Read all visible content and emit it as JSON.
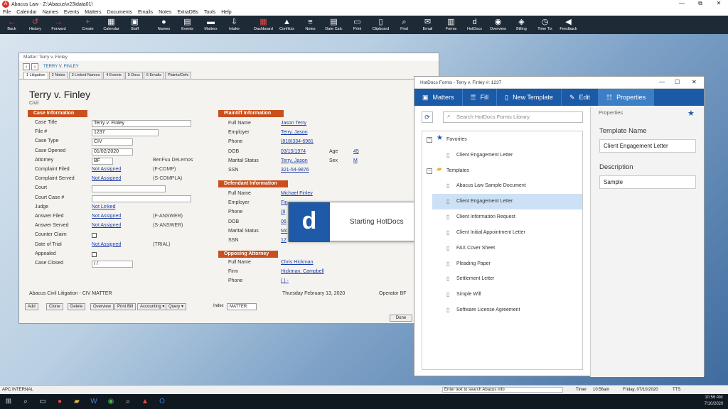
{
  "app": {
    "title": "Abacus Law - Z:\\Abacus\\v23\\data01\\",
    "logo": "A",
    "minimize": "—",
    "maximize": "⧉",
    "close": "✕"
  },
  "menu": [
    "File",
    "Calendar",
    "Names",
    "Events",
    "Matters",
    "Documents",
    "Emails",
    "Notes",
    "ExtraDBs",
    "Tools",
    "Help"
  ],
  "toolbar": [
    {
      "label": "Back",
      "icon": "←",
      "red": true
    },
    {
      "label": "History",
      "icon": "↺",
      "red": true
    },
    {
      "label": "Forward",
      "icon": "→",
      "red": true
    },
    {
      "label": "Create",
      "icon": "+",
      "red": true
    },
    {
      "label": "Calendar",
      "icon": "▦"
    },
    {
      "label": "Staff",
      "icon": "▣"
    },
    {
      "label": "Names",
      "icon": "●"
    },
    {
      "label": "Events",
      "icon": "▤"
    },
    {
      "label": "Matters",
      "icon": "▬"
    },
    {
      "label": "Intake",
      "icon": "⇩"
    },
    {
      "label": "Dashboard",
      "icon": "▦",
      "red": true
    },
    {
      "label": "Conflicts",
      "icon": "▲"
    },
    {
      "label": "Notes",
      "icon": "≡"
    },
    {
      "label": "Date Calc",
      "icon": "▤"
    },
    {
      "label": "Print",
      "icon": "▭"
    },
    {
      "label": "Clipboard",
      "icon": "▯"
    },
    {
      "label": "Find",
      "icon": "⌕"
    },
    {
      "label": "Email",
      "icon": "✉"
    },
    {
      "label": "Forms",
      "icon": "▥"
    },
    {
      "label": "HotDocs",
      "icon": "d"
    },
    {
      "label": "Overview",
      "icon": "◉"
    },
    {
      "label": "Billing",
      "icon": "◈"
    },
    {
      "label": "Time Tix",
      "icon": "◷"
    },
    {
      "label": "Feedback",
      "icon": "◀"
    }
  ],
  "matter": {
    "window_title": "Matter: Terry v. Finley",
    "nav_label": "TERRY V. FINLEY",
    "tabs": [
      "1 Litigation",
      "2 Notes",
      "3 Linked Names",
      "4 Events",
      "5 Docs",
      "6 Emails",
      "Plaints/Defs"
    ],
    "title": "Terry v. Finley",
    "subtitle": "Civil",
    "case_header": "Case Information",
    "case_fields": [
      {
        "label": "Case Title",
        "value": "Terry v. Finley",
        "kind": "box"
      },
      {
        "label": "File #",
        "value": "1237",
        "kind": "box"
      },
      {
        "label": "Case Type",
        "value": "CIV",
        "kind": "box"
      },
      {
        "label": "Case Opened",
        "value": "01/02/2020",
        "kind": "box"
      },
      {
        "label": "Attorney",
        "value": "BF",
        "kind": "box",
        "note": "BenFuu DeLemos"
      },
      {
        "label": "Complaint Filed",
        "value": "Not Assigned",
        "kind": "link",
        "note": "(F-COMP)"
      },
      {
        "label": "Complaint Served",
        "value": "Not Assigned",
        "kind": "link",
        "note": "(S-COMPLA)"
      },
      {
        "label": "Court",
        "value": "",
        "kind": "box"
      },
      {
        "label": "Court Case #",
        "value": "",
        "kind": "box"
      },
      {
        "label": "Judge",
        "value": "Not Linked",
        "kind": "link"
      },
      {
        "label": "Answer Filed",
        "value": "Not Assigned",
        "kind": "link",
        "note": "(F-ANSWER)"
      },
      {
        "label": "Answer Served",
        "value": "Not Assigned",
        "kind": "link",
        "note": "(S-ANSWER)"
      },
      {
        "label": "Counter Claim",
        "value": "",
        "kind": "check"
      },
      {
        "label": "Date of Trial",
        "value": "Not Assigned",
        "kind": "link",
        "note": "(TRIAL)"
      },
      {
        "label": "Appealed",
        "value": "",
        "kind": "check"
      },
      {
        "label": "Case Closed",
        "value": "/ /",
        "kind": "box"
      }
    ],
    "plaintiff_header": "Plaintiff Information",
    "plaintiff": [
      {
        "label": "Full Name",
        "value": "Jason Terry"
      },
      {
        "label": "Employer",
        "value": "Terry, Jason"
      },
      {
        "label": "Phone",
        "value": "(818)334-6981"
      },
      {
        "label": "DOB",
        "value": "03/15/1974"
      },
      {
        "label": "Marital Status",
        "value": "Terry, Jason"
      },
      {
        "label": "SSN",
        "value": "321-54-9876"
      }
    ],
    "plaintiff_extra": {
      "age_label": "Age",
      "age": "45",
      "sex_label": "Sex",
      "sex": "M"
    },
    "defendant_header": "Defendant Information",
    "defendant": [
      {
        "label": "Full Name",
        "value": "Michael Finley"
      },
      {
        "label": "Employer",
        "value": "Fin"
      },
      {
        "label": "Phone",
        "value": "(8"
      },
      {
        "label": "DOB",
        "value": "06"
      },
      {
        "label": "Marital Status",
        "value": "Mc"
      },
      {
        "label": "SSN",
        "value": "12"
      }
    ],
    "opposing_header": "Opposing Attorney",
    "opposing": [
      {
        "label": "Full Name",
        "value": "Chris Hickman"
      },
      {
        "label": "Firm",
        "value": "Hickman, Campbell"
      },
      {
        "label": "Phone",
        "value": "( ) -"
      }
    ],
    "footer_left": "Abacus Civil Litigation - CIV MATTER",
    "footer_date": "Thursday February 13, 2020",
    "footer_operator": "Operator BF",
    "buttons": [
      "Add",
      "Clone",
      "Delete",
      "Overview",
      "Print Bill",
      "Accounting ▾",
      "Query ▾"
    ],
    "index_label": "Index",
    "index_value": "MATTER",
    "done": "Done"
  },
  "splash": {
    "logo": "d",
    "text": "Starting HotDocs"
  },
  "hotdocs": {
    "window_title": "HotDocs Forms - Terry v. Finley #: 1237",
    "tabs": [
      {
        "label": "Matters",
        "icon": "▣"
      },
      {
        "label": "Fill",
        "icon": "☰"
      },
      {
        "label": "New Template",
        "icon": "▯"
      },
      {
        "label": "Edit",
        "icon": "✎"
      },
      {
        "label": "Properties",
        "icon": "☷"
      }
    ],
    "search_placeholder": "Search HotDocs Forms Library",
    "favorites_label": "Favorites",
    "favorites": [
      "Client Engagement Letter"
    ],
    "templates_label": "Templates",
    "templates": [
      "Abacus Law Sample Document",
      "Client Engagement Letter",
      "Client Information Request",
      "Client Initial Appointment Letter",
      "FAX Cover Sheet",
      "Pleading Paper",
      "Settlement Letter",
      "Simple Will",
      "Software License Agreement"
    ],
    "props_header": "Properties",
    "template_name_label": "Template Name",
    "template_name": "Client Engagement Letter",
    "description_label": "Description",
    "description": "Sample"
  },
  "status": {
    "left": "APC INTERNAL",
    "search": "Enter text to search Abacus info",
    "timer": "Timer",
    "time_val": "10:56am",
    "date": "Friday, 07/10/2020",
    "tts": "TTS"
  },
  "taskbar": {
    "clock": "10:56 AM",
    "date": "7/10/2020"
  },
  "colors": {
    "accent": "#1a5aa6",
    "section": "#c9501e",
    "toolbar": "#1f2a37"
  }
}
